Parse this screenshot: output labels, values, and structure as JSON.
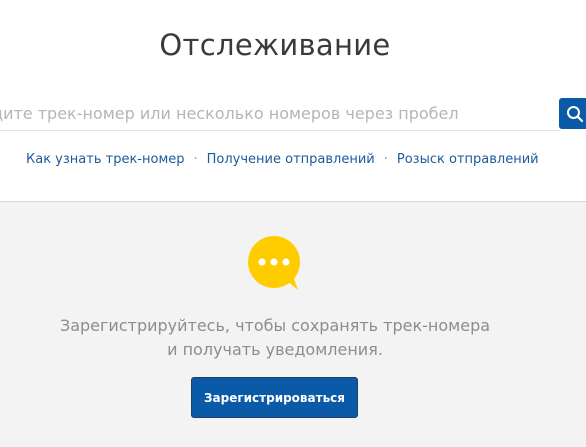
{
  "header": {
    "title": "Отслеживание"
  },
  "search": {
    "placeholder": "дите трек-номер или несколько номеров через пробел",
    "value": "",
    "button_icon": "search-icon",
    "accent_color": "#0a5aa8"
  },
  "links": [
    {
      "label": "Как узнать трек-номер"
    },
    {
      "label": "Получение отправлений"
    },
    {
      "label": "Розыск отправлений"
    }
  ],
  "link_separator": "·",
  "promo": {
    "icon": "chat-bubble-icon",
    "icon_color": "#ffcc00",
    "line1": "Зарегистрируйтесь, чтобы сохранять трек-номера",
    "line2": "и получать уведомления.",
    "button_label": "Зарегистрироваться"
  }
}
